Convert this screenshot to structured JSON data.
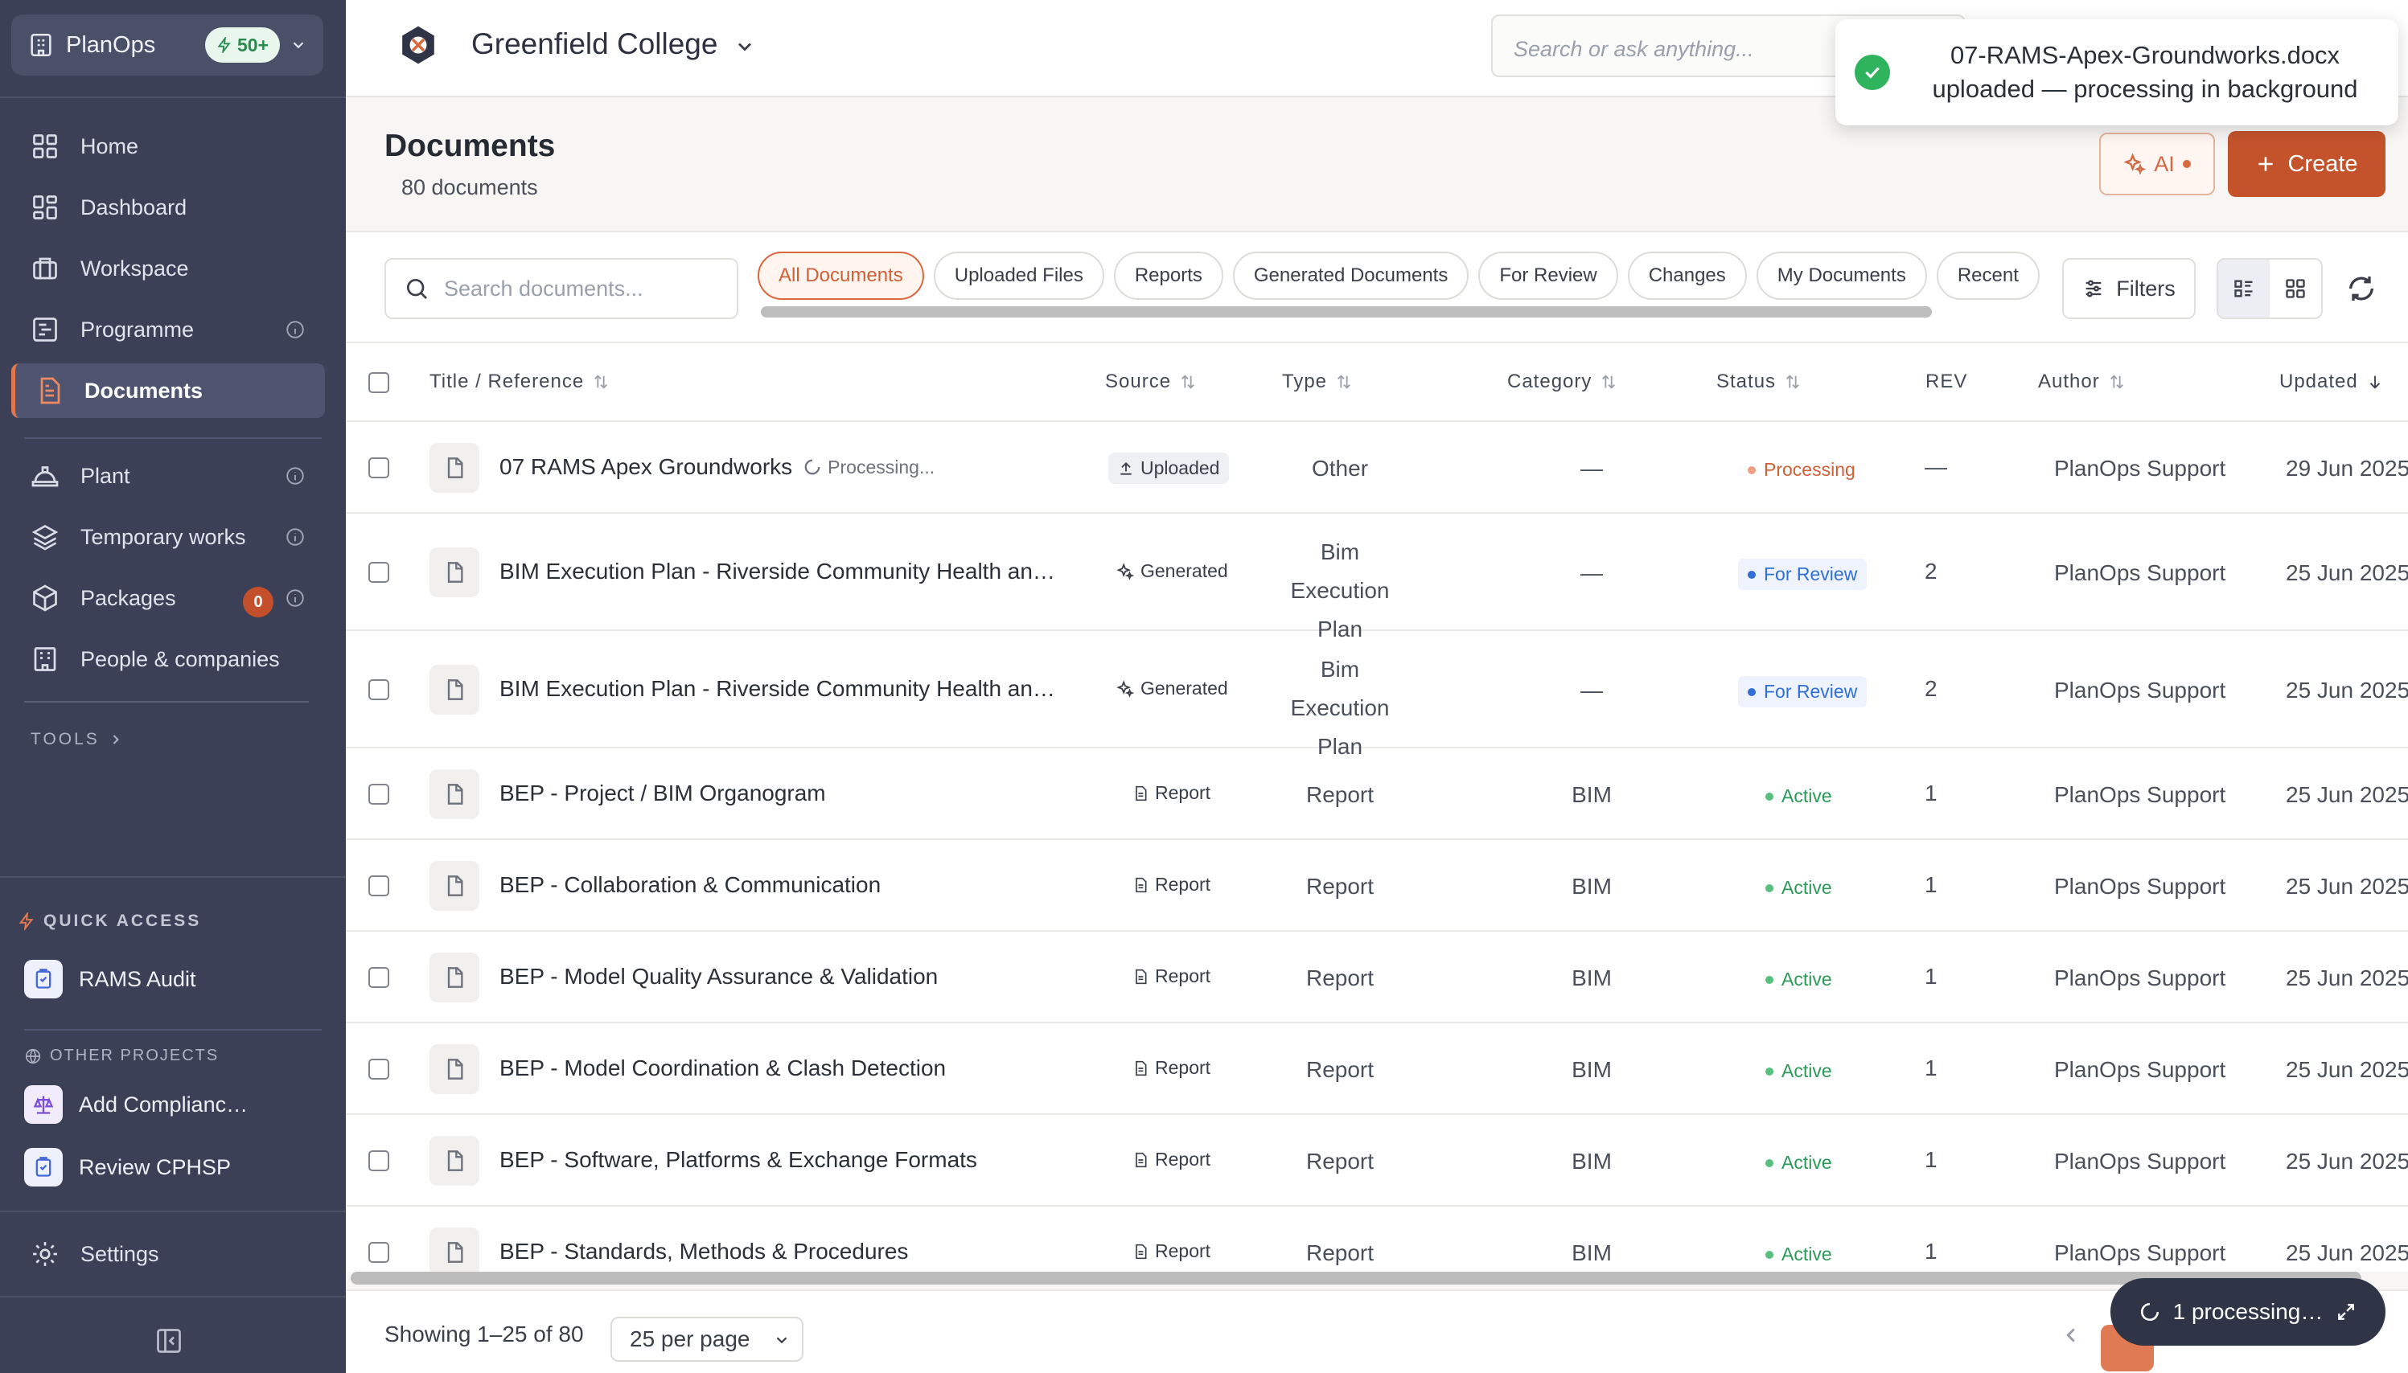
{
  "app": {
    "name": "PlanOps",
    "badge": "50+"
  },
  "sidebar": {
    "items": [
      {
        "label": "Home",
        "icon": "grid-icon"
      },
      {
        "label": "Dashboard",
        "icon": "dashboard-icon"
      },
      {
        "label": "Workspace",
        "icon": "briefcase-icon"
      },
      {
        "label": "Programme",
        "icon": "gantt-icon"
      },
      {
        "label": "Documents",
        "icon": "document-icon",
        "active": true
      },
      {
        "label": "Plant",
        "icon": "helmet-icon"
      },
      {
        "label": "Temporary works",
        "icon": "layers-icon"
      },
      {
        "label": "Packages",
        "icon": "package-icon",
        "count": "0"
      },
      {
        "label": "People & companies",
        "icon": "building-icon"
      }
    ],
    "tools_label": "TOOLS",
    "quick_access_label": "QUICK ACCESS",
    "quick_access": [
      {
        "label": "RAMS Audit"
      }
    ],
    "other_projects_label": "OTHER PROJECTS",
    "other_projects": [
      {
        "label": "Add Complianc…"
      },
      {
        "label": "Review CPHSP"
      }
    ],
    "settings_label": "Settings"
  },
  "header": {
    "college": "Greenfield College",
    "search_placeholder": "Search or ask anything..."
  },
  "toast": {
    "message": "07-RAMS-Apex-Groundworks.docx uploaded — processing in background"
  },
  "page": {
    "title": "Documents",
    "subtitle": "80 documents",
    "ai_label": "AI",
    "create_label": "Create"
  },
  "filters": {
    "search_placeholder": "Search documents...",
    "chips": [
      "All Documents",
      "Uploaded Files",
      "Reports",
      "Generated Documents",
      "For Review",
      "Changes",
      "My Documents",
      "Recent"
    ],
    "active_chip": "All Documents",
    "filters_label": "Filters"
  },
  "table": {
    "columns": {
      "title": "Title / Reference",
      "source": "Source",
      "type": "Type",
      "category": "Category",
      "status": "Status",
      "rev": "REV",
      "author": "Author",
      "updated": "Updated"
    },
    "rows": [
      {
        "title": "07 RAMS Apex Groundworks",
        "processing": "Processing...",
        "source": "Uploaded",
        "type": "Other",
        "category": "—",
        "status": "Processing",
        "rev": "—",
        "author": "PlanOps Support",
        "updated": "29 Jun 2025"
      },
      {
        "title": "BIM Execution Plan - Riverside Community Health an…",
        "source": "Generated",
        "type": "Bim Execution Plan",
        "category": "—",
        "status": "For Review",
        "rev": "2",
        "author": "PlanOps Support",
        "updated": "25 Jun 2025"
      },
      {
        "title": "BIM Execution Plan - Riverside Community Health an…",
        "source": "Generated",
        "type": "Bim Execution Plan",
        "category": "—",
        "status": "For Review",
        "rev": "2",
        "author": "PlanOps Support",
        "updated": "25 Jun 2025"
      },
      {
        "title": "BEP - Project / BIM Organogram",
        "source": "Report",
        "type": "Report",
        "category": "BIM",
        "status": "Active",
        "rev": "1",
        "author": "PlanOps Support",
        "updated": "25 Jun 2025"
      },
      {
        "title": "BEP - Collaboration & Communication",
        "source": "Report",
        "type": "Report",
        "category": "BIM",
        "status": "Active",
        "rev": "1",
        "author": "PlanOps Support",
        "updated": "25 Jun 2025"
      },
      {
        "title": "BEP - Model Quality Assurance & Validation",
        "source": "Report",
        "type": "Report",
        "category": "BIM",
        "status": "Active",
        "rev": "1",
        "author": "PlanOps Support",
        "updated": "25 Jun 2025"
      },
      {
        "title": "BEP - Model Coordination & Clash Detection",
        "source": "Report",
        "type": "Report",
        "category": "BIM",
        "status": "Active",
        "rev": "1",
        "author": "PlanOps Support",
        "updated": "25 Jun 2025"
      },
      {
        "title": "BEP - Software, Platforms & Exchange Formats",
        "source": "Report",
        "type": "Report",
        "category": "BIM",
        "status": "Active",
        "rev": "1",
        "author": "PlanOps Support",
        "updated": "25 Jun 2025"
      },
      {
        "title": "BEP - Standards, Methods & Procedures",
        "source": "Report",
        "type": "Report",
        "category": "BIM",
        "status": "Active",
        "rev": "1",
        "author": "PlanOps Support",
        "updated": "25 Jun 2025"
      }
    ]
  },
  "footer": {
    "showing": "Showing 1–25 of 80",
    "per_page": "25 per page",
    "processing_label": "1 processing…"
  },
  "colors": {
    "sidebar_bg": "#3b4057",
    "accent": "#c4532c",
    "processing": "#d9683e",
    "review": "#2f6fd6",
    "active": "#2a9a57"
  }
}
